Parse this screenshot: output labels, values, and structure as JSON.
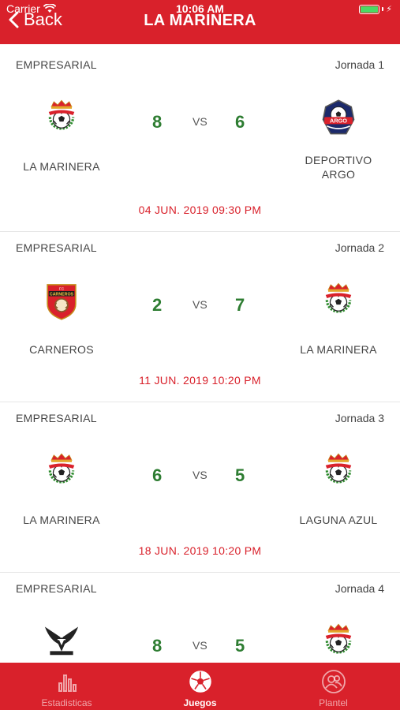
{
  "status_bar": {
    "carrier": "Carrier",
    "time": "10:06 AM"
  },
  "header": {
    "back_label": "Back",
    "title": "LA MARINERA"
  },
  "games": [
    {
      "league": "EMPRESARIAL",
      "round": "Jornada 1",
      "home": {
        "name": "LA MARINERA",
        "logo": "la-marinera-crest"
      },
      "away": {
        "name": "DEPORTIVO ARGO",
        "logo": "argo-crest"
      },
      "home_score": "8",
      "away_score": "6",
      "vs": "VS",
      "date": "04 JUN. 2019 09:30 PM"
    },
    {
      "league": "EMPRESARIAL",
      "round": "Jornada 2",
      "home": {
        "name": "CARNEROS",
        "logo": "carneros-crest"
      },
      "away": {
        "name": "LA MARINERA",
        "logo": "la-marinera-crest"
      },
      "home_score": "2",
      "away_score": "7",
      "vs": "VS",
      "date": "11 JUN. 2019 10:20 PM"
    },
    {
      "league": "EMPRESARIAL",
      "round": "Jornada 3",
      "home": {
        "name": "LA MARINERA",
        "logo": "la-marinera-crest"
      },
      "away": {
        "name": "LAGUNA AZUL",
        "logo": "la-marinera-crest"
      },
      "home_score": "6",
      "away_score": "5",
      "vs": "VS",
      "date": "18 JUN. 2019 10:20 PM"
    },
    {
      "league": "EMPRESARIAL",
      "round": "Jornada 4",
      "home": {
        "name": "",
        "logo": "vimetal-crest"
      },
      "away": {
        "name": "",
        "logo": "la-marinera-crest"
      },
      "home_score": "8",
      "away_score": "5",
      "vs": "VS",
      "date": ""
    }
  ],
  "tabs": [
    {
      "label": "Estadisticas",
      "icon": "bar-chart-icon",
      "active": false
    },
    {
      "label": "Juegos",
      "icon": "soccer-ball-icon",
      "active": true
    },
    {
      "label": "Plantel",
      "icon": "people-icon",
      "active": false
    }
  ],
  "colors": {
    "brand_red": "#d9212b",
    "score_green": "#2e7d32",
    "battery_green": "#4cd964"
  }
}
